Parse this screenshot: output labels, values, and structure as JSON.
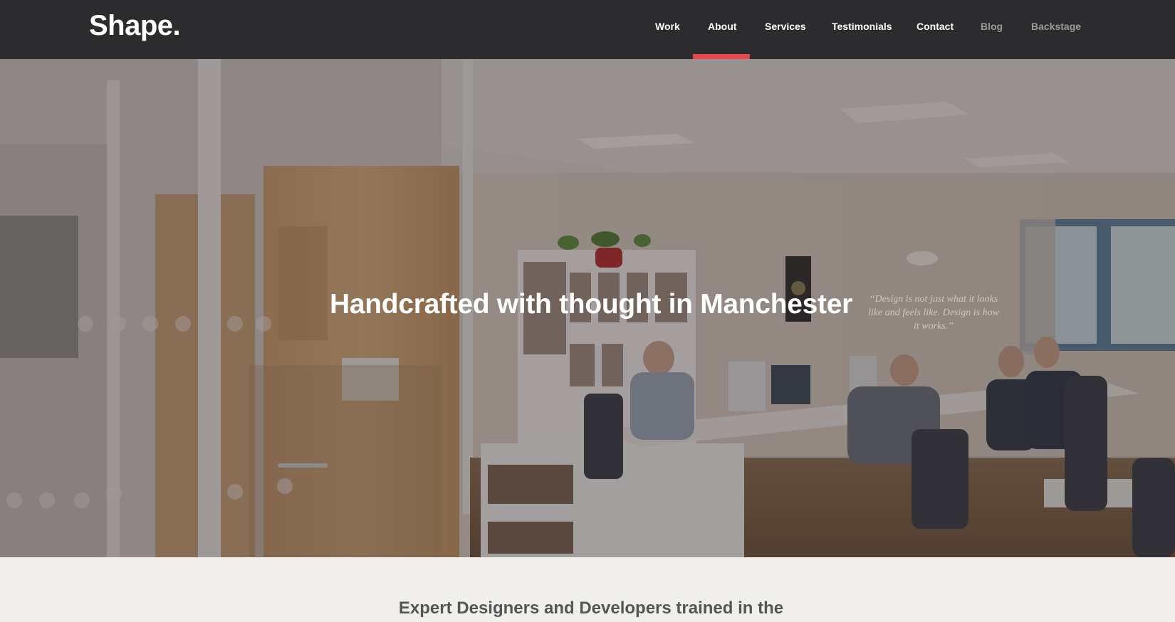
{
  "brand": {
    "logo_text": "Shape."
  },
  "nav": {
    "items": [
      {
        "label": "Work",
        "active": false
      },
      {
        "label": "About",
        "active": true
      },
      {
        "label": "Services",
        "active": false
      },
      {
        "label": "Testimonials",
        "active": false
      },
      {
        "label": "Contact",
        "active": false
      },
      {
        "label": "Blog",
        "active": false
      },
      {
        "label": "Backstage",
        "active": false
      }
    ]
  },
  "hero": {
    "title": "Handcrafted with thought in Manchester",
    "wall_quote": "“Design is not just what it looks like and feels like. Design is how it works.”"
  },
  "intro": {
    "heading": "Expert Designers and Developers trained in the"
  },
  "colors": {
    "navbar_bg": "#2c2c2e",
    "accent": "#e8474f",
    "nav_text": "#ffffff",
    "nav_text_dim": "#9a9a9a",
    "intro_bg": "#f0efec",
    "intro_text": "#555555"
  }
}
